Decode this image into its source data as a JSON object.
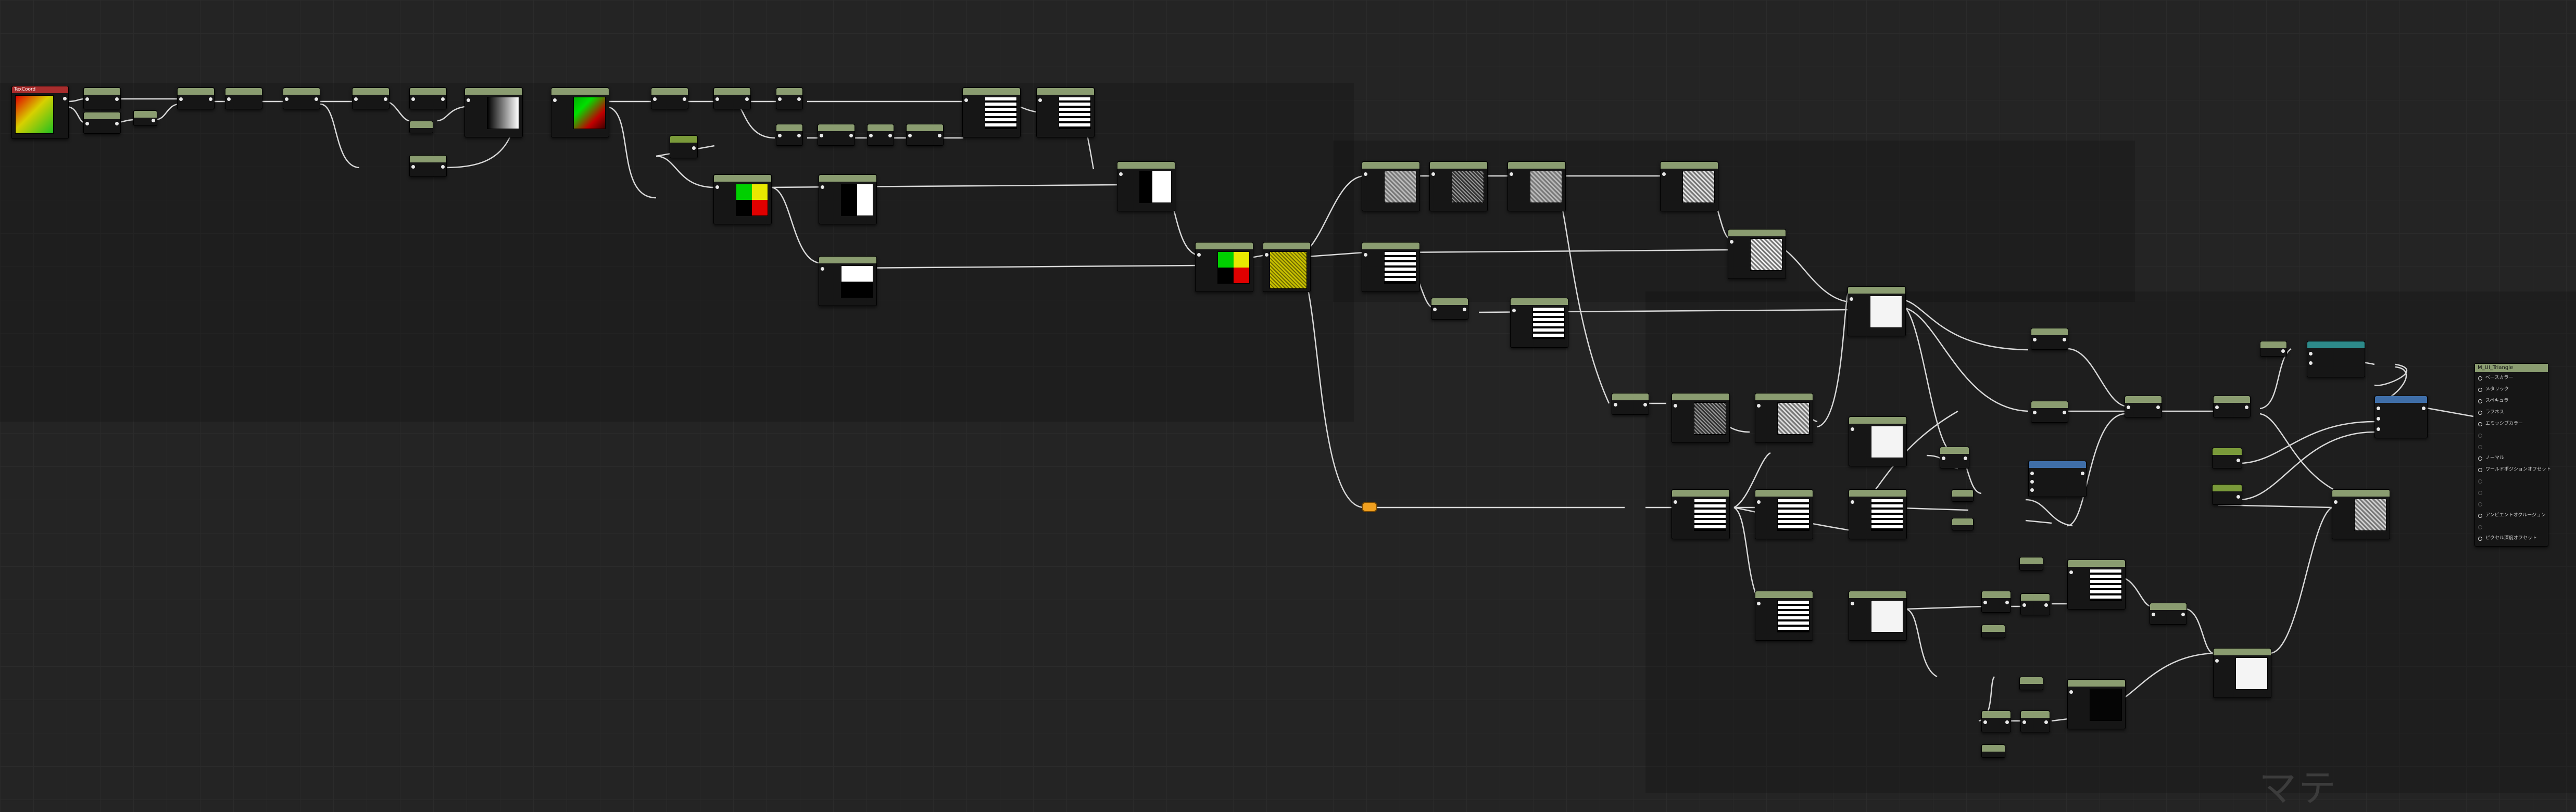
{
  "texture_node": {
    "label": "TexCoord"
  },
  "output_node": {
    "title": "M_UI_Triangle",
    "pins": [
      "ベースカラー",
      "メタリック",
      "スペキュラ",
      "ラフネス",
      "エミッシブカラー",
      "",
      "",
      "ノーマル",
      "ワールドポジションオフセット",
      "",
      "",
      "",
      "アンビエントオクルージョン",
      "",
      "ピクセル深度オフセット"
    ]
  },
  "watermark": {
    "text": "マテ"
  },
  "colors": {
    "header": "#8a9c70",
    "wire": "#d8d8d8",
    "reroute": "#f0a020",
    "background": "#242424"
  }
}
